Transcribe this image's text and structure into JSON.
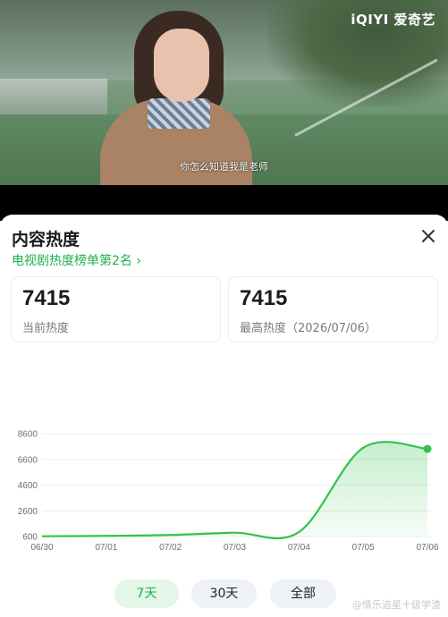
{
  "video": {
    "logo": "iQIYI 爱奇艺",
    "subtitle": "你怎么知道我是老师"
  },
  "sheet": {
    "title": "内容热度",
    "rank_link": "电视剧热度榜单第2名",
    "cards": [
      {
        "value": "7415",
        "label": "当前热度"
      },
      {
        "value": "7415",
        "label": "最高热度（2026/07/06）"
      }
    ]
  },
  "tabs": [
    {
      "label": "7天",
      "active": true
    },
    {
      "label": "30天",
      "active": false
    },
    {
      "label": "全部",
      "active": false
    }
  ],
  "watermark": "@情乐追星十级学渣",
  "colors": {
    "accent": "#21b04b",
    "line": "#33c24d"
  },
  "chart_data": {
    "type": "area",
    "title": "",
    "xlabel": "",
    "ylabel": "",
    "x": [
      "06/30",
      "07/01",
      "07/02",
      "07/03",
      "07/04",
      "07/05",
      "07/06"
    ],
    "yticks": [
      600,
      2600,
      4600,
      6600,
      8600
    ],
    "ylim": [
      600,
      8600
    ],
    "series": [
      {
        "points": [
          {
            "x": "06/30",
            "y": 620
          },
          {
            "x": "07/01",
            "y": 650
          },
          {
            "x": "07/02",
            "y": 720
          },
          {
            "x": "07/03",
            "y": 900
          },
          {
            "x": "07/04",
            "y": 950
          },
          {
            "x": "07/05",
            "y": 7500
          },
          {
            "x": "07/06",
            "y": 7415
          }
        ]
      }
    ],
    "grid": true,
    "legend": "none"
  }
}
